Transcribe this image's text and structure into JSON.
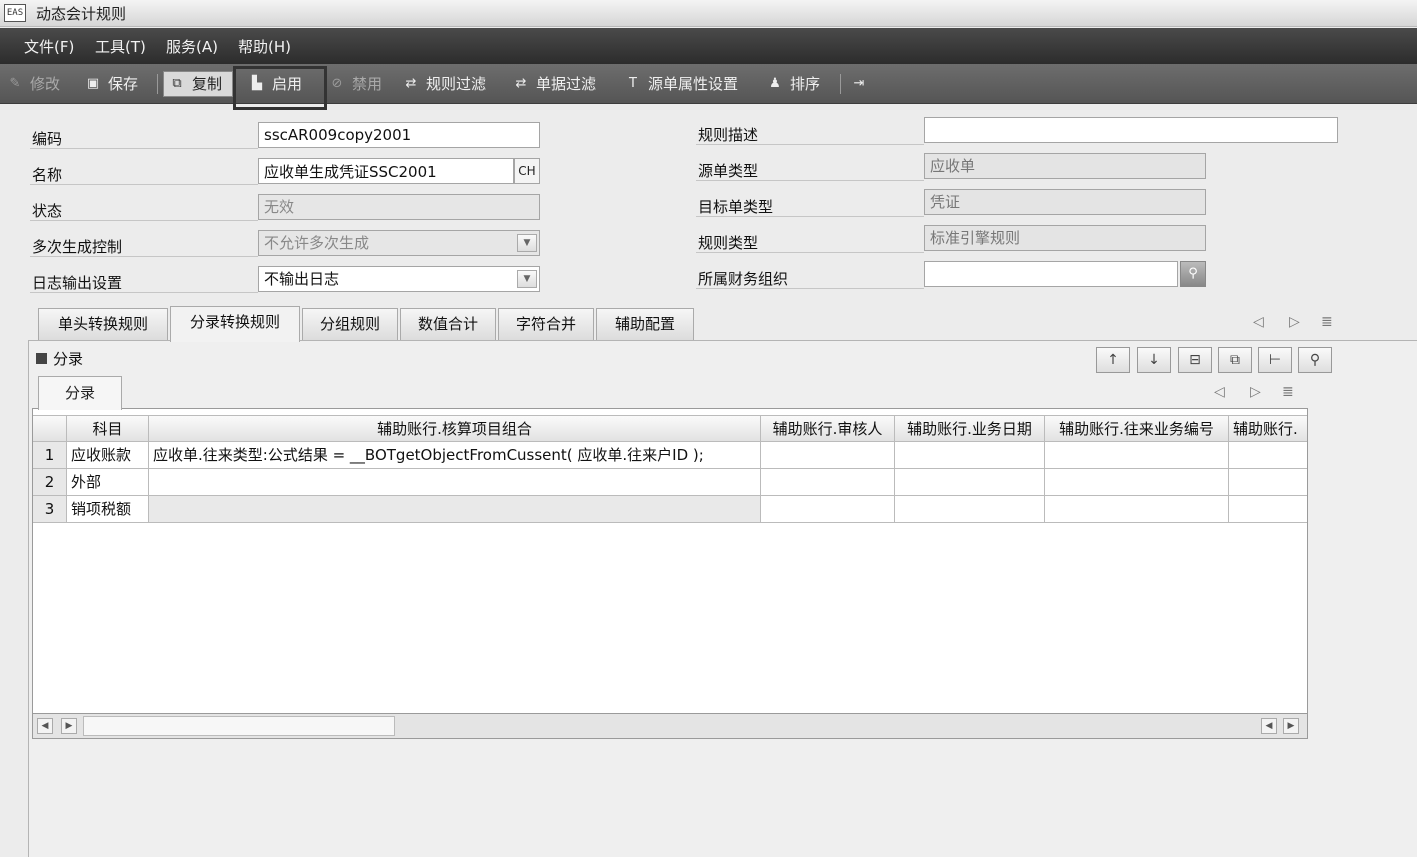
{
  "window": {
    "icon_text": "EAS",
    "title": "动态会计规则"
  },
  "menu": [
    "文件(F)",
    "工具(T)",
    "服务(A)",
    "帮助(H)"
  ],
  "toolbar": {
    "edit": "修改",
    "save": "保存",
    "copy": "复制",
    "enable": "启用",
    "disable": "禁用",
    "rule_filter": "规则过滤",
    "doc_filter": "单据过滤",
    "source_attr": "源单属性设置",
    "sort": "排序"
  },
  "form": {
    "code_label": "编码",
    "code_value": "sscAR009copy2001",
    "name_label": "名称",
    "name_value": "应收单生成凭证SSC2001",
    "name_lang": "CH",
    "status_label": "状态",
    "status_value": "无效",
    "multi_label": "多次生成控制",
    "multi_value": "不允许多次生成",
    "log_label": "日志输出设置",
    "log_value": "不输出日志",
    "desc_label": "规则描述",
    "desc_value": "",
    "source_type_label": "源单类型",
    "source_type_value": "应收单",
    "target_type_label": "目标单类型",
    "target_type_value": "凭证",
    "rule_type_label": "规则类型",
    "rule_type_value": "标准引擎规则",
    "org_label": "所属财务组织",
    "org_value": ""
  },
  "tabs": [
    "单头转换规则",
    "分录转换规则",
    "分组规则",
    "数值合计",
    "字符合并",
    "辅助配置"
  ],
  "section": {
    "title": "分录",
    "subtab": "分录"
  },
  "grid": {
    "headers": [
      "科目",
      "辅助账行.核算项目组合",
      "辅助账行.审核人",
      "辅助账行.业务日期",
      "辅助账行.往来业务编号",
      "辅助账行."
    ],
    "rows": [
      {
        "num": "1",
        "subject": "应收账款",
        "combo": "应收单.往来类型:公式结果 = __BOTgetObjectFromCussent( 应收单.往来户ID );"
      },
      {
        "num": "2",
        "subject": "外部",
        "combo": ""
      },
      {
        "num": "3",
        "subject": "销项税额",
        "combo": ""
      }
    ]
  }
}
